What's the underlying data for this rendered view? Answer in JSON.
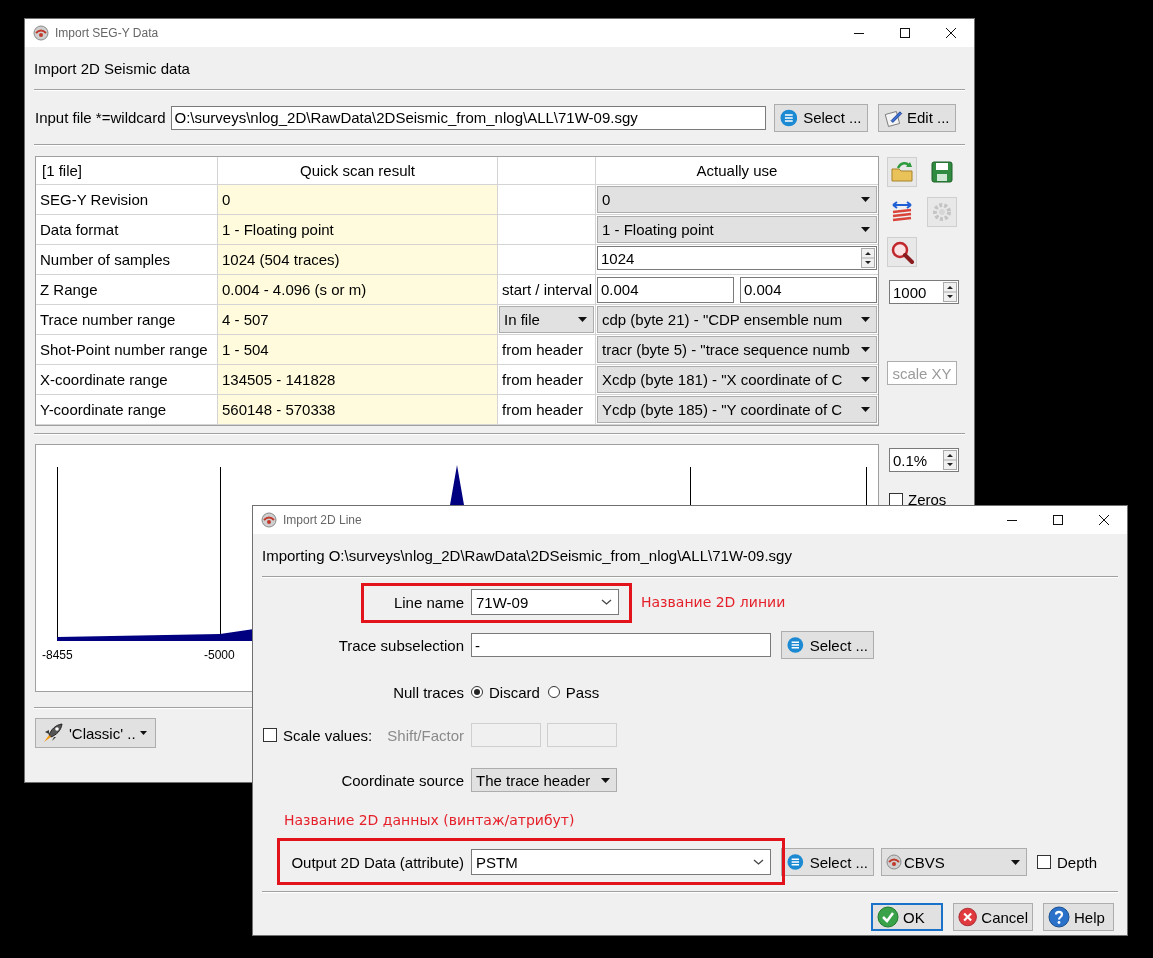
{
  "back_window": {
    "title": "Import SEG-Y Data",
    "heading": "Import 2D Seismic data",
    "input_file": {
      "label": "Input file *=wildcard",
      "value": "O:\\surveys\\nlog_2D\\RawData\\2DSeismic_from_nlog\\ALL\\71W-09.sgy",
      "select_button": "Select ...",
      "edit_button": "Edit ..."
    },
    "scan_table": {
      "header": {
        "column_1": "[1 file]",
        "column_2": "Quick scan result",
        "column_4": "Actually use"
      },
      "rows": [
        {
          "label": "SEG-Y Revision",
          "scan": "0",
          "kind": "combo",
          "use": "0"
        },
        {
          "label": "Data format",
          "scan": "1 - Floating point",
          "kind": "combo",
          "use": "1 - Floating point"
        },
        {
          "label": "Number of samples",
          "scan": "1024 (504 traces)",
          "kind": "spin",
          "use": "1024"
        },
        {
          "label": "Z Range",
          "scan": "0.004 - 4.096 (s or m)",
          "source": {
            "kind": "text",
            "label": "start / interval"
          },
          "kind": "pair",
          "start": "0.004",
          "interval": "0.004"
        },
        {
          "label": "Trace number range",
          "scan": "4 - 507",
          "source": {
            "kind": "combo",
            "label": "In file"
          },
          "kind": "combo",
          "use": "cdp (byte 21) - \"CDP ensemble num"
        },
        {
          "label": "Shot-Point number range",
          "scan": "1 - 504",
          "source": {
            "kind": "text",
            "label": "from header"
          },
          "kind": "combo",
          "use": "tracr (byte 5) - \"trace sequence numb"
        },
        {
          "label": "X-coordinate range",
          "scan": "134505 - 141828",
          "source": {
            "kind": "text",
            "label": "from header"
          },
          "kind": "combo",
          "use": "Xcdp (byte 181) - \"X coordinate of C"
        },
        {
          "label": "Y-coordinate range",
          "scan": "560148 - 570338",
          "source": {
            "kind": "text",
            "label": "from header"
          },
          "kind": "combo",
          "use": "Ycdp (byte 185) - \"Y coordinate of C"
        }
      ]
    },
    "z_count": "1000",
    "scale_button": {
      "label": "scale XY",
      "disabled": true
    },
    "histogram": {
      "clip": "0.1%",
      "zeros": {
        "label": "Zeros",
        "checked": false
      },
      "axis_labels": [
        "-8455",
        "-5000"
      ]
    },
    "preset_button": "'Classic' .."
  },
  "front_window": {
    "title": "Import 2D Line",
    "importing": "Importing O:\\surveys\\nlog_2D\\RawData\\2DSeismic_from_nlog\\ALL\\71W-09.sgy",
    "line_name": {
      "label": "Line name",
      "value": "71W-09",
      "highlighted": true,
      "note": "Название 2D линии"
    },
    "trace_subselection": {
      "label": "Trace subselection",
      "value": "-",
      "button": "Select ..."
    },
    "null_traces": {
      "label": "Null traces",
      "options": [
        {
          "label": "Discard",
          "selected": true
        },
        {
          "label": "Pass",
          "selected": false
        }
      ]
    },
    "scale_values": {
      "label": "Scale values:",
      "checked": false,
      "factor_label": "Shift/Factor",
      "factor_disabled": true
    },
    "coordinate_source": {
      "label": "Coordinate source",
      "value": "The trace header"
    },
    "output_note": "Название 2D данных (винтаж/атрибут)",
    "output": {
      "label": "Output 2D Data (attribute)",
      "value": "PSTM",
      "highlighted": true,
      "select_button": "Select ...",
      "format": "CBVS",
      "depth": {
        "label": "Depth",
        "checked": false
      }
    },
    "buttons": [
      {
        "label": "OK",
        "kind": "ok",
        "default": true
      },
      {
        "label": "Cancel",
        "kind": "cancel",
        "default": false
      },
      {
        "label": "Help",
        "kind": "help",
        "default": false
      }
    ]
  }
}
